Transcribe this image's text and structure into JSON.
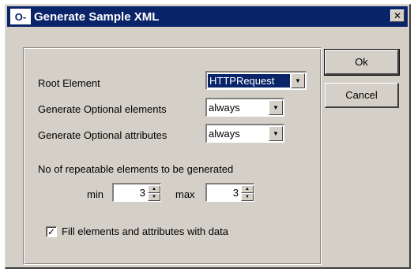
{
  "window": {
    "title": "Generate Sample XML",
    "icon_label": "O-",
    "close_label": "✕"
  },
  "form": {
    "root_element_label": "Root Element",
    "root_element_value": "HTTPRequest",
    "optional_elements_label": "Generate Optional elements",
    "optional_elements_value": "always",
    "optional_attributes_label": "Generate Optional attributes",
    "optional_attributes_value": "always",
    "repeatable_label": "No of repeatable elements to be generated",
    "min_label": "min",
    "min_value": "3",
    "max_label": "max",
    "max_value": "3",
    "fill_data_label": "Fill elements and attributes with data",
    "fill_data_checked": true,
    "check_glyph": "✓"
  },
  "buttons": {
    "ok_label": "Ok",
    "cancel_label": "Cancel"
  },
  "icons": {
    "dropdown": "▼",
    "spin_up": "▲",
    "spin_down": "▼"
  },
  "colors": {
    "titlebar": "#0a246a",
    "face": "#d4d0c8",
    "selection": "#0a246a"
  }
}
